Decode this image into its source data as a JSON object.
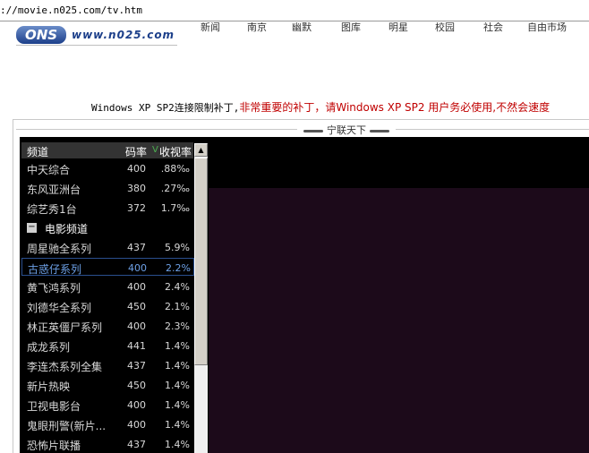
{
  "browser": {
    "url": "://movie.n025.com/tv.htm"
  },
  "header": {
    "logo_badge": "ONS",
    "logo_text": "www.n025.com",
    "nav": [
      "新闻",
      "南京",
      "幽默",
      "图库",
      "明星",
      "校园",
      "社会",
      "自由市场"
    ]
  },
  "notice": {
    "part1": "Windows XP SP2连接限制补丁,",
    "part2": "非常重要的补丁，请Windows XP SP2 用户务必使用,不然会速度"
  },
  "panel": {
    "title": "宁联天下"
  },
  "channel_list": {
    "headers": {
      "name": "频道",
      "rate": "码率",
      "sort_marker": "V",
      "share": "收视率"
    },
    "rows_top": [
      {
        "name": "中天综合",
        "rate": "400",
        "share": ".88‰"
      },
      {
        "name": "东风亚洲台",
        "rate": "380",
        "share": ".27‰"
      },
      {
        "name": "综艺秀1台",
        "rate": "372",
        "share": "1.7‰"
      }
    ],
    "group": {
      "toggle": "−",
      "label": "电影频道"
    },
    "rows_movie": [
      {
        "name": "周星驰全系列",
        "rate": "437",
        "share": "5.9%"
      },
      {
        "name": "古惑仔系列",
        "rate": "400",
        "share": "2.2%"
      },
      {
        "name": "黄飞鸿系列",
        "rate": "400",
        "share": "2.4%"
      },
      {
        "name": "刘德华全系列",
        "rate": "450",
        "share": "2.1%"
      },
      {
        "name": "林正英僵尸系列",
        "rate": "400",
        "share": "2.3%"
      },
      {
        "name": "成龙系列",
        "rate": "441",
        "share": "1.4%"
      },
      {
        "name": "李连杰系列全集",
        "rate": "437",
        "share": "1.4%"
      },
      {
        "name": "新片热映",
        "rate": "450",
        "share": "1.4%"
      },
      {
        "name": "卫视电影台",
        "rate": "400",
        "share": "1.4%"
      },
      {
        "name": "鬼眼刑警(新片...",
        "rate": "400",
        "share": "1.4%"
      },
      {
        "name": "恐怖片联播",
        "rate": "437",
        "share": "1.4%"
      }
    ]
  }
}
